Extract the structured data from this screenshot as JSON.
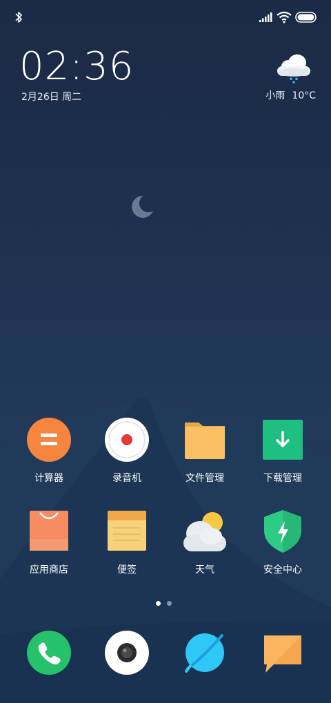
{
  "status_bar": {
    "icons": [
      "bluetooth-icon",
      "signal-icon",
      "wifi-icon",
      "battery-icon"
    ]
  },
  "clock": {
    "time": "02:36",
    "date": "2月26日 周二"
  },
  "weather": {
    "icon": "rain-cloud-icon",
    "condition": "小雨",
    "temperature": "10°C"
  },
  "home_apps": [
    {
      "label": "计算器",
      "icon": "calculator-icon"
    },
    {
      "label": "录音机",
      "icon": "recorder-icon"
    },
    {
      "label": "文件管理",
      "icon": "folder-icon"
    },
    {
      "label": "下载管理",
      "icon": "download-icon"
    },
    {
      "label": "应用商店",
      "icon": "shopping-bag-icon"
    },
    {
      "label": "便签",
      "icon": "notes-icon"
    },
    {
      "label": "天气",
      "icon": "weather-icon"
    },
    {
      "label": "安全中心",
      "icon": "shield-icon"
    }
  ],
  "page_indicator": {
    "count": 2,
    "active": 1
  },
  "dock": [
    {
      "icon": "phone-icon"
    },
    {
      "icon": "camera-icon"
    },
    {
      "icon": "browser-icon"
    },
    {
      "icon": "messages-icon"
    }
  ],
  "colors": {
    "calculator": "#f5853f",
    "recorder_dot": "#e53935",
    "folder": "#fbbf63",
    "download": "#1fbf82",
    "store": "#f78b62",
    "notes": "#f6d27a",
    "shield": "#2ecb85",
    "phone": "#25c26b",
    "browser": "#2fc7f5",
    "messages": "#fbb45f"
  }
}
